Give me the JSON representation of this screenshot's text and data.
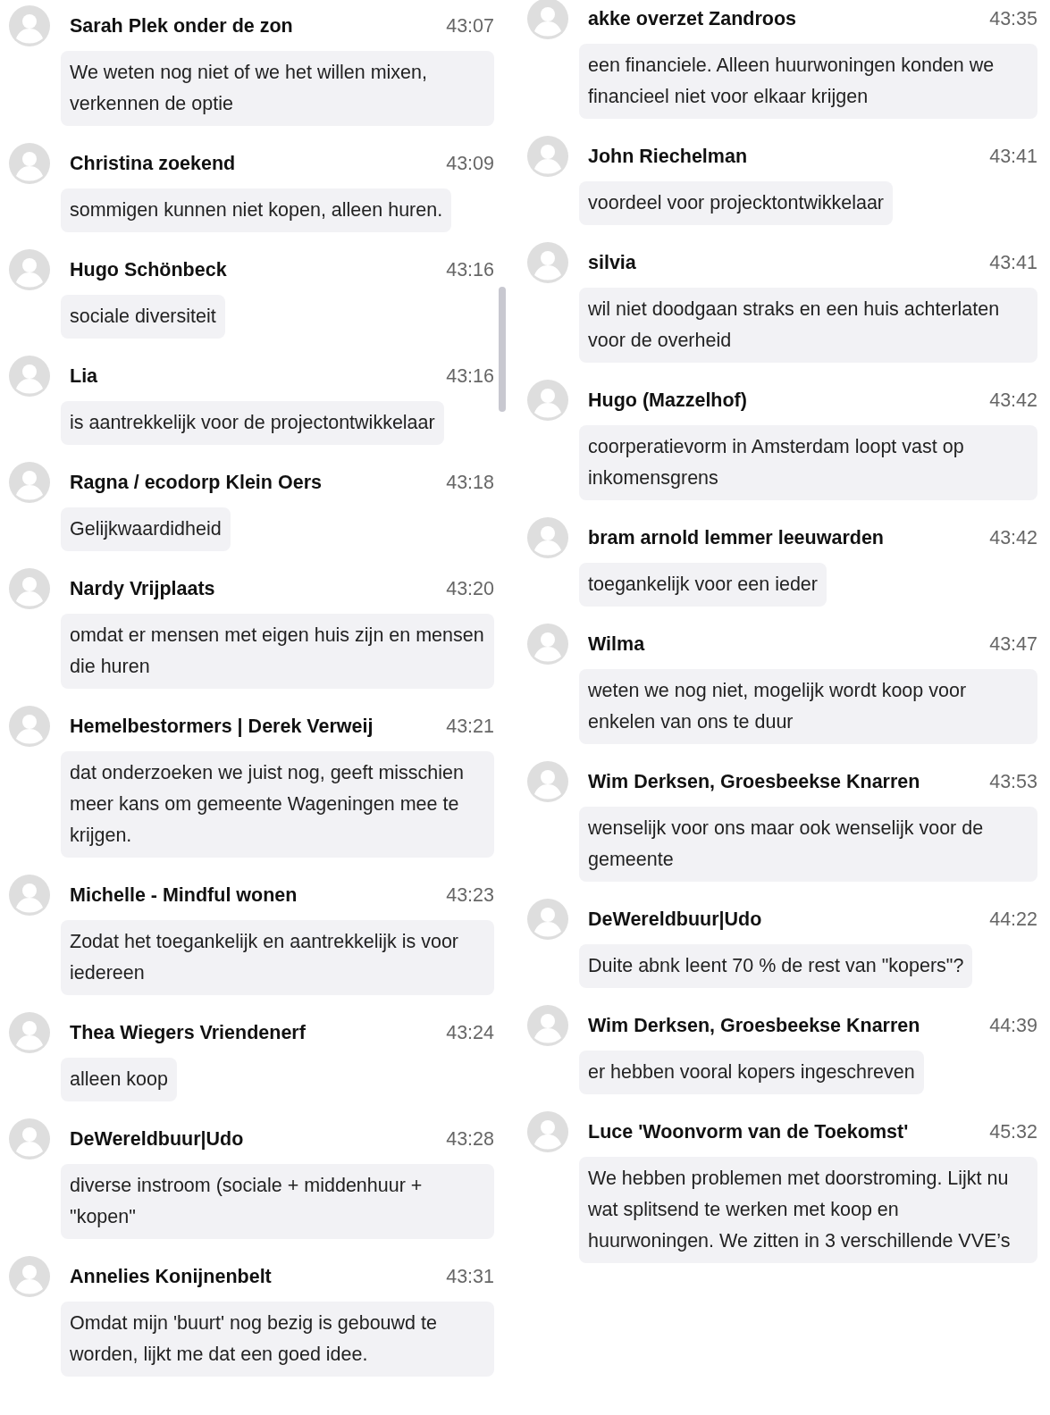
{
  "columns": [
    {
      "messages": [
        {
          "name": "Sarah Plek onder de zon",
          "time": "43:07",
          "text": "We weten nog niet of we het willen mixen, verkennen de optie"
        },
        {
          "name": "Christina zoekend",
          "time": "43:09",
          "text": "sommigen kunnen niet kopen, alleen huren."
        },
        {
          "name": "Hugo Schönbeck",
          "time": "43:16",
          "text": "sociale diversiteit"
        },
        {
          "name": "Lia",
          "time": "43:16",
          "text": "is aantrekkelijk voor de projectontwikkelaar"
        },
        {
          "name": "Ragna / ecodorp Klein Oers",
          "time": "43:18",
          "text": "Gelijkwaardidheid"
        },
        {
          "name": "Nardy Vrijplaats",
          "time": "43:20",
          "text": "omdat er mensen met eigen huis zijn en mensen die huren"
        },
        {
          "name": "Hemelbestormers | Derek Verweij",
          "time": "43:21",
          "text": "dat onderzoeken we juist nog, geeft misschien meer kans om gemeente Wageningen mee te krijgen."
        },
        {
          "name": "Michelle - Mindful wonen",
          "time": "43:23",
          "text": "Zodat het toegankelijk en aantrekkelijk is voor iedereen"
        },
        {
          "name": "Thea Wiegers Vriendenerf",
          "time": "43:24",
          "text": "alleen koop"
        },
        {
          "name": "DeWereldbuur|Udo",
          "time": "43:28",
          "text": "diverse instroom (sociale + middenhuur + \"kopen\""
        },
        {
          "name": "Annelies Konijnenbelt",
          "time": "43:31",
          "text": "Omdat mijn 'buurt' nog bezig is gebouwd te worden, lijkt me dat een goed idee."
        }
      ]
    },
    {
      "messages": [
        {
          "name": "akke overzet Zandroos",
          "time": "43:35",
          "text": "een financiele. Alleen huurwoningen konden we financieel niet voor elkaar krijgen"
        },
        {
          "name": "John Riechelman",
          "time": "43:41",
          "text": "voordeel voor projecktontwikkelaar"
        },
        {
          "name": "silvia",
          "time": "43:41",
          "text": "wil niet doodgaan straks en een huis achterlaten voor de overheid"
        },
        {
          "name": "Hugo (Mazzelhof)",
          "time": "43:42",
          "text": "coorperatievorm in Amsterdam loopt vast op inkomensgrens"
        },
        {
          "name": "bram arnold lemmer leeuwarden",
          "time": "43:42",
          "text": "toegankelijk voor een ieder"
        },
        {
          "name": "Wilma",
          "time": "43:47",
          "text": "weten we nog niet, mogelijk wordt koop voor enkelen van ons te duur"
        },
        {
          "name": "Wim Derksen, Groesbeekse Knarren",
          "time": "43:53",
          "text": "wenselijk voor ons maar ook wenselijk voor de gemeente"
        },
        {
          "name": "DeWereldbuur|Udo",
          "time": "44:22",
          "text": "Duite abnk leent 70 % de rest van \"kopers\"?"
        },
        {
          "name": "Wim Derksen, Groesbeekse Knarren",
          "time": "44:39",
          "text": "er hebben vooral kopers ingeschreven"
        },
        {
          "name": "Luce 'Woonvorm van de Toekomst'",
          "time": "45:32",
          "text": "We hebben problemen met doorstroming. Lijkt nu wat splitsend te werken met koop en huurwoningen. We zitten in 3 verschillende VVE’s"
        }
      ]
    }
  ]
}
